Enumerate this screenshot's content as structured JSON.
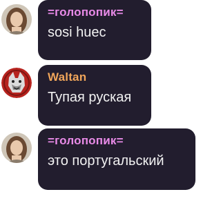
{
  "chat": {
    "messages": [
      {
        "author": "=голопопик=",
        "author_color": "#e98be8",
        "text": "sosi huec",
        "avatar_icon": "user-avatar-woman-icon"
      },
      {
        "author": "Waltan",
        "author_color": "#f0a55a",
        "text": "Тупая руская",
        "avatar_icon": "user-avatar-wolf-icon"
      },
      {
        "author": "=голопопик=",
        "author_color": "#e98be8",
        "text": "это португальский",
        "avatar_icon": "user-avatar-woman-icon"
      }
    ]
  }
}
